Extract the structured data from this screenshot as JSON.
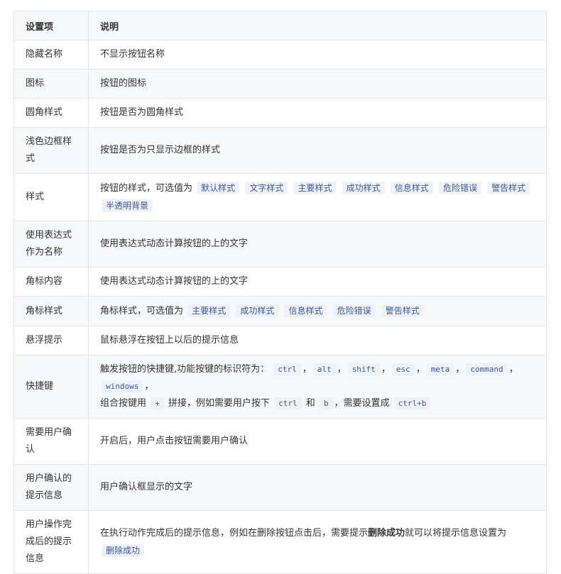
{
  "header": {
    "col1": "设置项",
    "col2": "说明"
  },
  "rows": [
    {
      "key": "隐藏名称",
      "desc": "不显示按钮名称"
    },
    {
      "key": "图标",
      "desc": "按钮的图标"
    },
    {
      "key": "圆角样式",
      "desc": "按钮是否为圆角样式"
    },
    {
      "key": "浅色边框样式",
      "desc": "按钮是否为只显示边框的样式"
    },
    {
      "key": "样式",
      "desc": "按钮的样式，可选值为",
      "tags": [
        "默认样式",
        "文字样式",
        "主要样式",
        "成功样式",
        "信息样式",
        "危险错误",
        "警告样式",
        "半透明背景"
      ]
    },
    {
      "key": "使用表达式作为名称",
      "desc": "使用表达式动态计算按钮的上的文字"
    },
    {
      "key": "角标内容",
      "desc": "使用表达式动态计算按钮的上的文字"
    },
    {
      "key": "角标样式",
      "desc": "角标样式，可选值为",
      "tags": [
        "主要样式",
        "成功样式",
        "信息样式",
        "危险错误",
        "警告样式"
      ]
    },
    {
      "key": "悬浮提示",
      "desc": "鼠标悬浮在按钮上以后的提示信息"
    },
    {
      "key": "快捷键",
      "desc": "触发按钮的快捷键,功能按键的标识符为：",
      "keys": [
        "ctrl",
        "alt",
        "shift",
        "esc",
        "meta",
        "command",
        "windows"
      ],
      "sep": "，",
      "line2_a": "组合按键用",
      "plus": "+",
      "line2_b": "拼接，例如需要用户按下",
      "ex1": "ctrl",
      "and": "和",
      "ex2": "b",
      "line2_c": "，需要设置成",
      "ex3": "ctrl+b"
    },
    {
      "key": "需要用户确认",
      "desc": "开启后，用户点击按钮需要用户确认"
    },
    {
      "key": "用户确认的提示信息",
      "desc": "用户确认框显示的文字"
    },
    {
      "key": "用户操作完成后的提示信息",
      "desc_a": "在执行动作完成后的提示信息，例如在删除按钮点击后，需要提示",
      "desc_bold": "删除成功",
      "desc_b": "就可以将提示信息设置为",
      "tag": "删除成功"
    }
  ]
}
